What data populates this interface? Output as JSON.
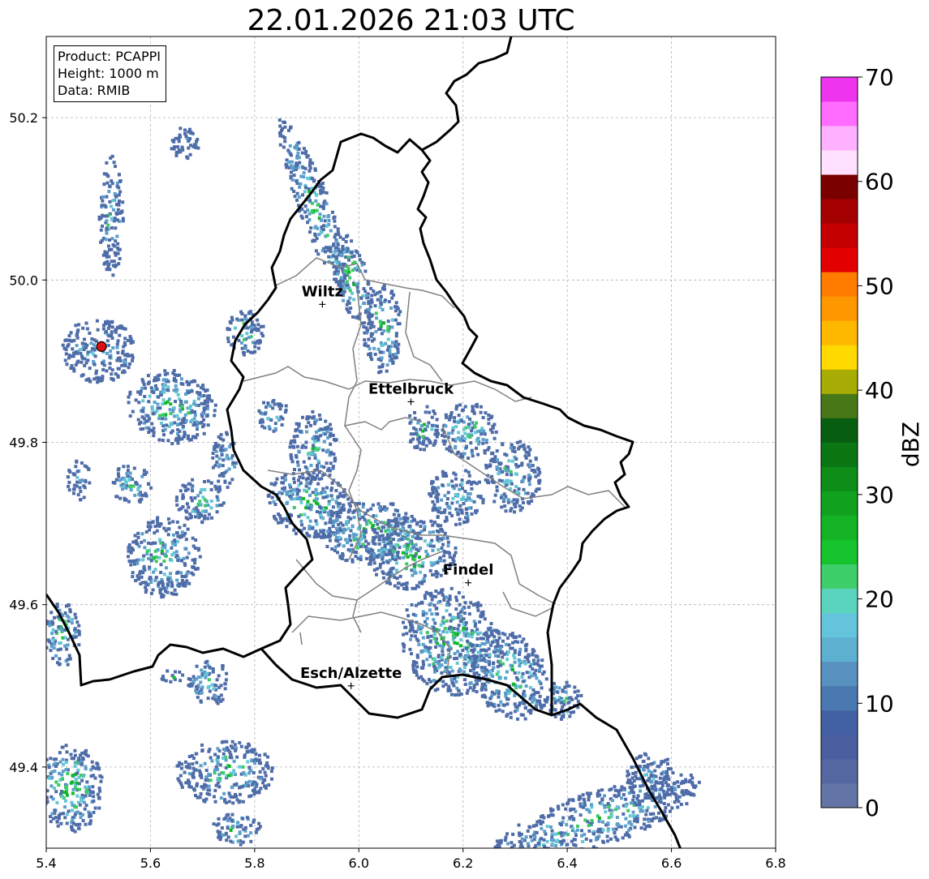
{
  "title": "22.01.2026 21:03 UTC",
  "info": {
    "product": "Product: PCAPPI",
    "height": "Height: 1000 m",
    "source": "Data: RMIB"
  },
  "axes": {
    "x_ticks": [
      "5.4",
      "5.6",
      "5.8",
      "6.0",
      "6.2",
      "6.4",
      "6.6",
      "6.8"
    ],
    "y_ticks": [
      "49.4",
      "49.6",
      "49.8",
      "50.0",
      "50.2"
    ],
    "x_range": [
      5.4,
      6.8
    ],
    "y_range": [
      49.3,
      50.3
    ],
    "grid": true
  },
  "cities": [
    {
      "name": "Wiltz",
      "lon": 5.93,
      "lat": 49.97
    },
    {
      "name": "Ettelbruck",
      "lon": 6.1,
      "lat": 49.85
    },
    {
      "name": "Findel",
      "lon": 6.21,
      "lat": 49.627
    },
    {
      "name": "Esch/Alzette",
      "lon": 5.985,
      "lat": 49.5
    }
  ],
  "radar_site": {
    "lon": 5.506,
    "lat": 49.918,
    "color": "#dd1111"
  },
  "colorbar": {
    "label": "dBZ",
    "min": 0,
    "max": 70,
    "ticks": [
      "0",
      "10",
      "20",
      "30",
      "40",
      "50",
      "60",
      "70"
    ],
    "colors": [
      "#6374a6",
      "#5567a0",
      "#4a5ea0",
      "#4260a2",
      "#4a78b0",
      "#5890bf",
      "#5eb0d0",
      "#64c4dc",
      "#5bd4be",
      "#3ecf6b",
      "#16c32c",
      "#13b325",
      "#10a11f",
      "#0d8d18",
      "#0a7614",
      "#085e10",
      "#477716",
      "#a9ac04",
      "#ffd900",
      "#ffb800",
      "#ff9700",
      "#ff7c00",
      "#e20000",
      "#c40000",
      "#a50000",
      "#7a0000",
      "#ffe1ff",
      "#ffb0ff",
      "#ff6cff",
      "#ee34ee"
    ]
  },
  "colors": {
    "border_country": "#000000",
    "border_canton": "#808080",
    "echo_weak": "#4e6ca8",
    "echo_light": "#5b9fcb",
    "echo_cyan": "#63c7d5",
    "echo_green": "#3ccb62",
    "echo_strong": "#12b62a"
  }
}
